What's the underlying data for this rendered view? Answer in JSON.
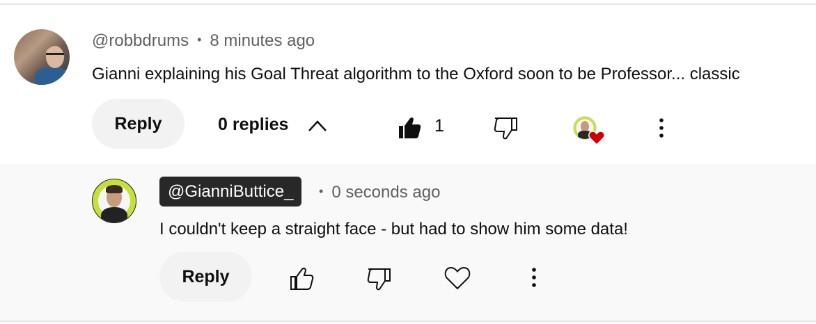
{
  "comment": {
    "author": "@robbdrums",
    "time": "8 minutes ago",
    "text": "Gianni explaining his Goal Threat algorithm to the Oxford soon to be Professor... classic",
    "reply_label": "Reply",
    "replies_label": "0 replies",
    "like_count": "1",
    "icons": [
      "avatar",
      "chevron-up-icon",
      "thumbs-up-filled-icon",
      "thumbs-down-icon",
      "creator-heart-icon",
      "more-vert-icon"
    ]
  },
  "reply": {
    "author": "@GianniButtice_",
    "time": "0 seconds ago",
    "text": "I couldn't keep a straight face - but had to show him some data!",
    "reply_label": "Reply",
    "icons": [
      "avatar",
      "thumbs-up-icon",
      "thumbs-down-icon",
      "heart-outline-icon",
      "more-vert-icon"
    ]
  },
  "dot": "•",
  "colors": {
    "meta_text": "#606060",
    "button_bg": "#f2f2f2",
    "reply_bg": "#f9f9f9",
    "badge_bg": "#282828",
    "heart_red": "#cc0000",
    "avatar_ring": "#c6e33a"
  }
}
